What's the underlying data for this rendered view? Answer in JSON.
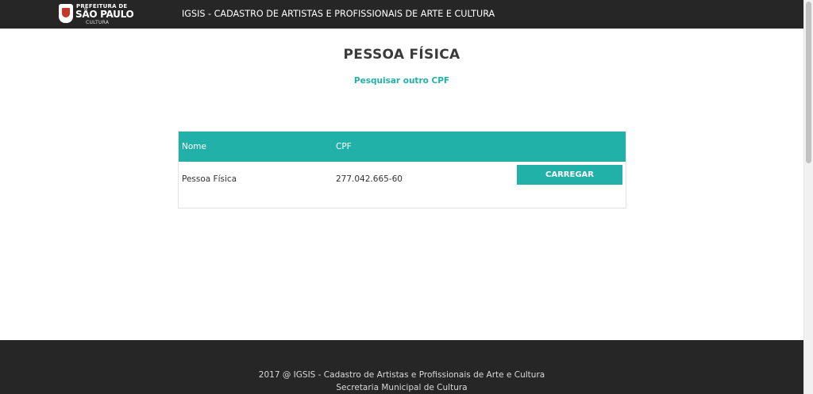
{
  "header": {
    "logo": {
      "line1": "PREFEITURA DE",
      "line2": "SÃO PAULO",
      "line3": "CULTURA"
    },
    "app_title": "IGSIS - CADASTRO DE ARTISTAS E PROFISSIONAIS DE ARTE E CULTURA"
  },
  "main": {
    "title": "PESSOA FÍSICA",
    "search_link": "Pesquisar outro CPF",
    "table": {
      "columns": [
        "Nome",
        "CPF"
      ],
      "rows": [
        {
          "nome": "Pessoa Física",
          "cpf": "277.042.665-60",
          "action_label": "CARREGAR"
        }
      ]
    }
  },
  "footer": {
    "line1": "2017 @ IGSIS - Cadastro de Artistas e Profissionais de Arte e Cultura",
    "line2": "Secretaria Municipal de Cultura"
  },
  "colors": {
    "accent": "#21b1a8",
    "header_bg": "#262626",
    "footer_bg": "#262626"
  }
}
